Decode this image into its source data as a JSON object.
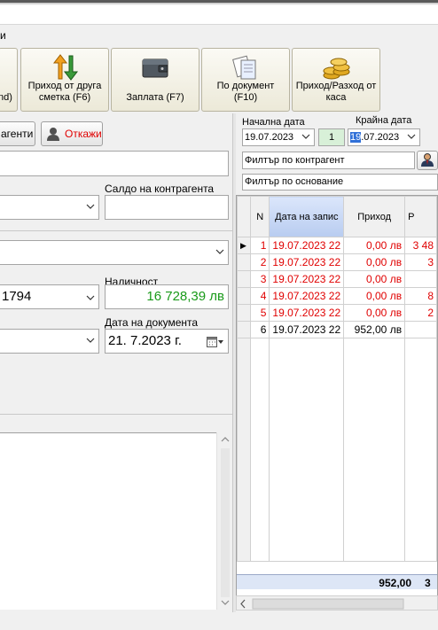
{
  "menu_fragment": "и",
  "toolbar": {
    "buttons": [
      {
        "label": "nd)",
        "icon": "partial-icon"
      },
      {
        "label": "Приход от друга сметка (F6)",
        "icon": "transfer-arrows-icon"
      },
      {
        "label": "Заплата (F7)",
        "icon": "wallet-icon"
      },
      {
        "label": "По документ (F10)",
        "icon": "documents-icon"
      },
      {
        "label": "Приход/Разход от каса",
        "icon": "coins-icon"
      }
    ]
  },
  "left": {
    "contractors_button": "агенти",
    "cancel_button": "Откажи",
    "contractor_balance_label": "Салдо на контрагента",
    "account_value": "1794",
    "cash_label": "Наличност",
    "cash_value": "16 728,39 лв",
    "doc_date_label": "Дата на документа",
    "doc_date_value": "21.  7.2023 г."
  },
  "right": {
    "start_date_label": "Начална дата",
    "end_date_label": "Крайна дата",
    "start_date": "19.07.2023",
    "day_count": "1",
    "end_date_sel": "19",
    "end_date_rest": ".07.2023",
    "filter_contractor": "Филтър по контрагент",
    "filter_basis": "Филтър по основание",
    "grid": {
      "columns": [
        "N",
        "Дата на запис",
        "Приход",
        "Р"
      ],
      "rows": [
        {
          "n": "1",
          "date": "19.07.2023 22",
          "income": "0,00 лв",
          "other": "3 48",
          "red": true
        },
        {
          "n": "2",
          "date": "19.07.2023 22",
          "income": "0,00 лв",
          "other": "3",
          "red": true
        },
        {
          "n": "3",
          "date": "19.07.2023 22",
          "income": "0,00 лв",
          "other": "",
          "red": true
        },
        {
          "n": "4",
          "date": "19.07.2023 22",
          "income": "0,00 лв",
          "other": "8",
          "red": true
        },
        {
          "n": "5",
          "date": "19.07.2023 22",
          "income": "0,00 лв",
          "other": "2",
          "red": true
        },
        {
          "n": "6",
          "date": "19.07.2023 22",
          "income": "952,00 лв",
          "other": "",
          "red": false
        }
      ],
      "footer": {
        "income": "952,00",
        "other": "3"
      }
    }
  },
  "colors": {
    "accent_green": "#1a9a1a",
    "red_text": "#e00000",
    "header_highlight": "#c8d8f8"
  }
}
